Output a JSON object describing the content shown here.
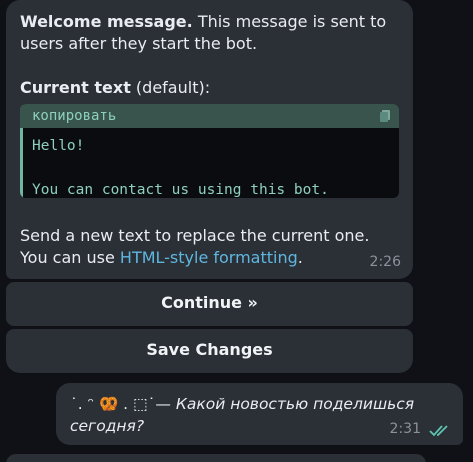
{
  "bot_message": {
    "welcome_bold": "Welcome message.",
    "welcome_text": " This message is sent to users after they start the bot.",
    "current_bold": "Current text",
    "current_rest": " (default):",
    "code": {
      "header": "копировать",
      "line1": "Hello!",
      "line2": "You can contact us using this bot."
    },
    "send_text": "Send a new text to replace the current one. You can use ",
    "link_text": "HTML-style formatting",
    "send_end": ".",
    "time": "2:26"
  },
  "keyboard": {
    "continue_label": "Continue »",
    "save_label": "Save Changes"
  },
  "outgoing_message": {
    "prefix": "˙. ᵔ 🥨 . ⬚˙— ",
    "text": "Какой новостью поделишься сегодня?",
    "time": "2:31"
  },
  "colors": {
    "accent": "#5fb7e0",
    "code": "#8fd0bd",
    "read_check": "#5ec4b0"
  },
  "icons": [
    "copy-icon",
    "double-check-icon"
  ]
}
